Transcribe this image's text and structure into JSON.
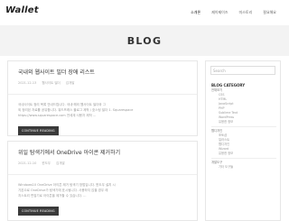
{
  "header": {
    "logo": "Wallet",
    "nav": [
      "소개론",
      "제이제이즈",
      "미스토리",
      "필요해요"
    ]
  },
  "hero": {
    "title": "BLOG"
  },
  "posts": [
    {
      "title": "국내외 웹사이트 빌더 장애 리스트",
      "date": "2021-12-13",
      "category": "웹사이트 빌더",
      "author": "김개발",
      "excerpt_lines": [
        "국내사이트 정리 목록 안내드립니다. 국내·해외 웹사이트 빌더와 그",
        "외 정리된 자료를 공유합니다. 워드프레스 블로그 제작 / 호스팅 빌더 1. Squarespace",
        "https://www.squarespace.com 전세계 사용자 제작 ..."
      ],
      "read_more": "CONTINUE READING"
    },
    {
      "title": "위일 탐색기에서 OneDrive 아이콘 제거하기",
      "date": "2021-12-10",
      "category": "윈도우",
      "author": "김개발",
      "excerpt_lines": [
        "Windows10 OneDrive 아이콘 제거 탐색기 방법입니다. 윈도우 설치 시",
        "기본으로 OneDrive가 탐색기에 표시됩니다. 사용하지 않을 경우 레",
        "지스트리 편집기로 아이콘을 제거할 수 있습니다. ..."
      ],
      "read_more": "CONTINUE READING"
    }
  ],
  "sidebar": {
    "search_placeholder": "Search",
    "category_heading": "BLOG CATEGORY",
    "categories": [
      {
        "label": "전체보기",
        "sub": false
      },
      {
        "label": "CSS",
        "sub": true
      },
      {
        "label": "HTML",
        "sub": true
      },
      {
        "label": "JavaScript",
        "sub": true
      },
      {
        "label": "PHP",
        "sub": true
      },
      {
        "label": "Sublime Text",
        "sub": true
      },
      {
        "label": "WordPress",
        "sub": true
      },
      {
        "label": "유용한 정보",
        "sub": true
      },
      {
        "label": "웹디자인",
        "sub": false
      },
      {
        "label": "포토샵",
        "sub": true
      },
      {
        "label": "일러스트",
        "sub": true
      },
      {
        "label": "웹디자인",
        "sub": true
      },
      {
        "label": "Wizard",
        "sub": true
      },
      {
        "label": "유용한 정보",
        "sub": true
      },
      {
        "label": "개발도구",
        "sub": false
      },
      {
        "label": "기타 도구들",
        "sub": true
      }
    ]
  }
}
